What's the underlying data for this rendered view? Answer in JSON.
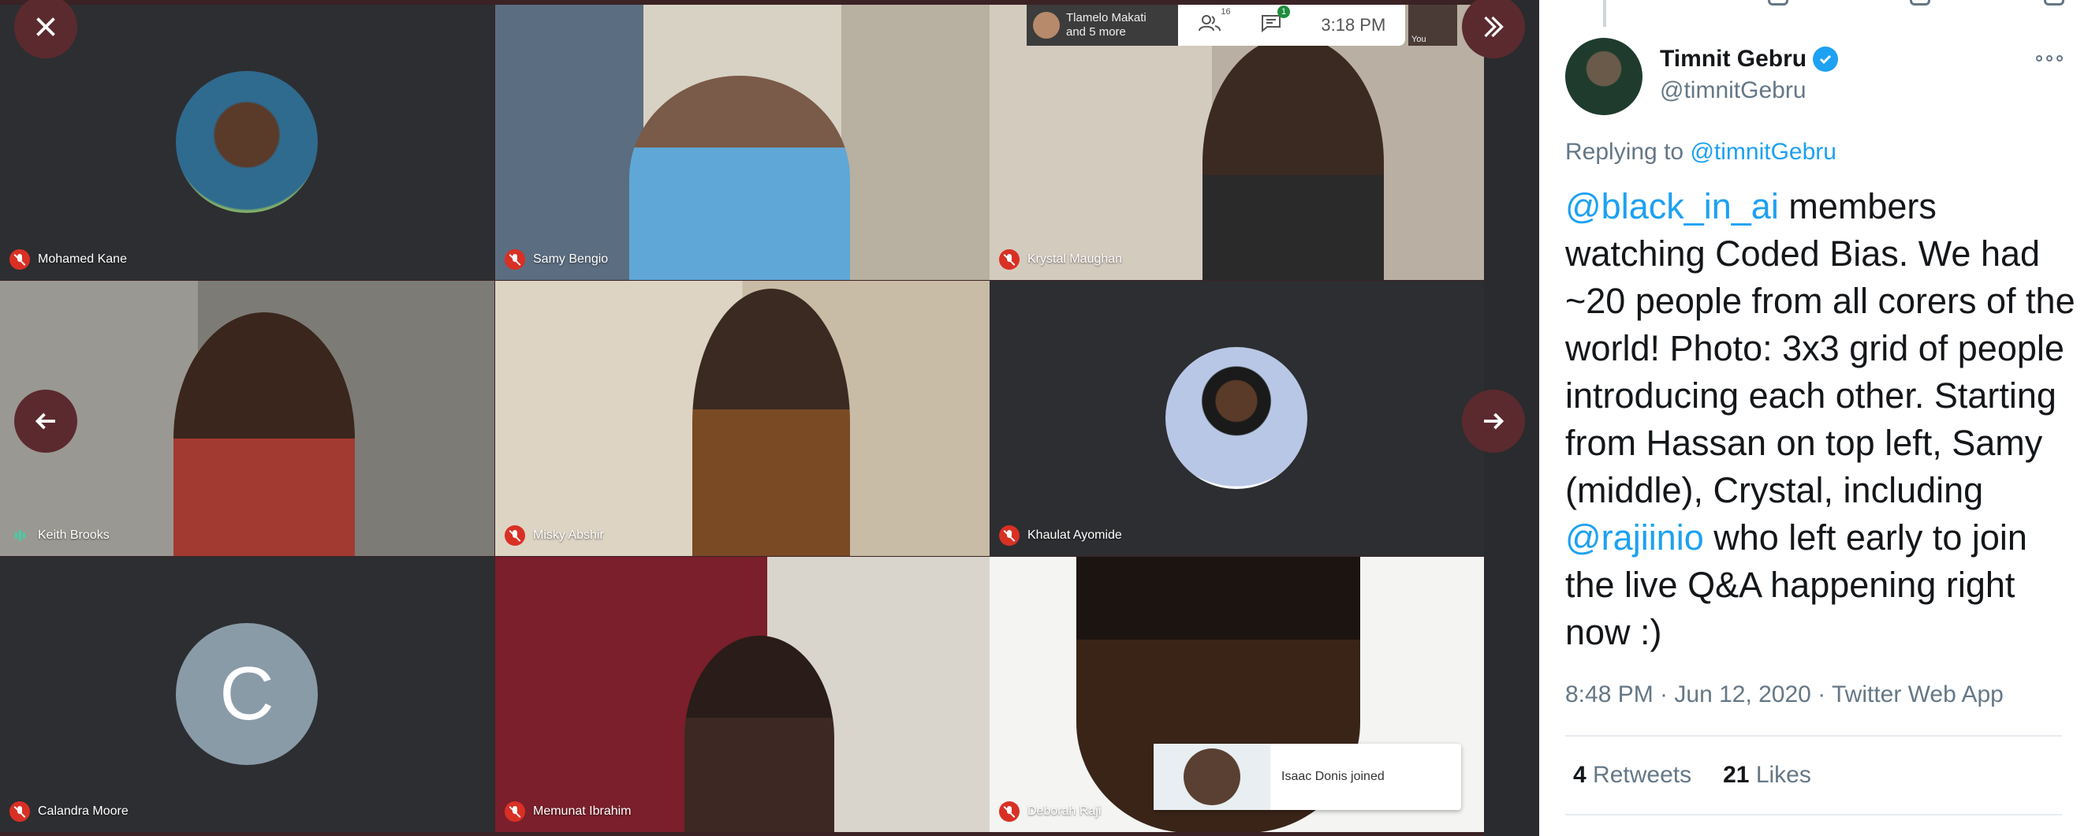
{
  "meeting": {
    "tiles": [
      {
        "name": "Mohamed Kane",
        "mic": "off",
        "style": "avatar",
        "bg": "#2d2e31"
      },
      {
        "name": "Samy Bengio",
        "mic": "off",
        "style": "video",
        "bg": "#a8a296"
      },
      {
        "name": "Krystal Maughan",
        "mic": "off",
        "style": "video",
        "bg": "#c9c1b6"
      },
      {
        "name": "Keith Brooks",
        "mic": "on",
        "style": "video",
        "bg": "#8c8a84"
      },
      {
        "name": "Misky Abshir",
        "mic": "off",
        "style": "video",
        "bg": "#cfc4b2"
      },
      {
        "name": "Khaulat Ayomide",
        "mic": "off",
        "style": "avatar",
        "bg": "#2d2e31"
      },
      {
        "name": "Calandra Moore",
        "mic": "off",
        "style": "letter",
        "letter": "C",
        "bg": "#2d2e31"
      },
      {
        "name": "Memunat Ibrahim",
        "mic": "off",
        "style": "video",
        "bg": "#7a1f2b"
      },
      {
        "name": "Deborah Raji",
        "mic": "off",
        "style": "video",
        "bg": "#ffffff"
      }
    ],
    "presenter": {
      "line1": "Tlamelo Makati",
      "line2": "and 5 more"
    },
    "participant_count": "16",
    "chat_count": "1",
    "time": "3:18 PM",
    "self_label": "You",
    "toast": "Isaac Donis joined"
  },
  "tweet": {
    "display_name": "Timnit Gebru",
    "handle": "@timnitGebru",
    "replying_prefix": "Replying to",
    "replying_to": "@timnitGebru",
    "body": {
      "mention1": "@black_in_ai",
      "text1": " members watching Coded Bias. We had ~20 people from all corers of the world! Photo: 3x3 grid of people introducing each other. Starting from Hassan on top left, Samy (middle), Crystal, including ",
      "mention2": "@rajiinio",
      "text2": " who left early to join the live Q&A happening right now :)"
    },
    "meta": "8:48 PM · Jun 12, 2020 · Twitter Web App",
    "retweets_count": "4",
    "retweets_label": "Retweets",
    "likes_count": "21",
    "likes_label": "Likes"
  },
  "colors": {
    "meet_accent": "#5b2a2e",
    "mute_red": "#d93025",
    "twitter_blue": "#1da1f2"
  }
}
